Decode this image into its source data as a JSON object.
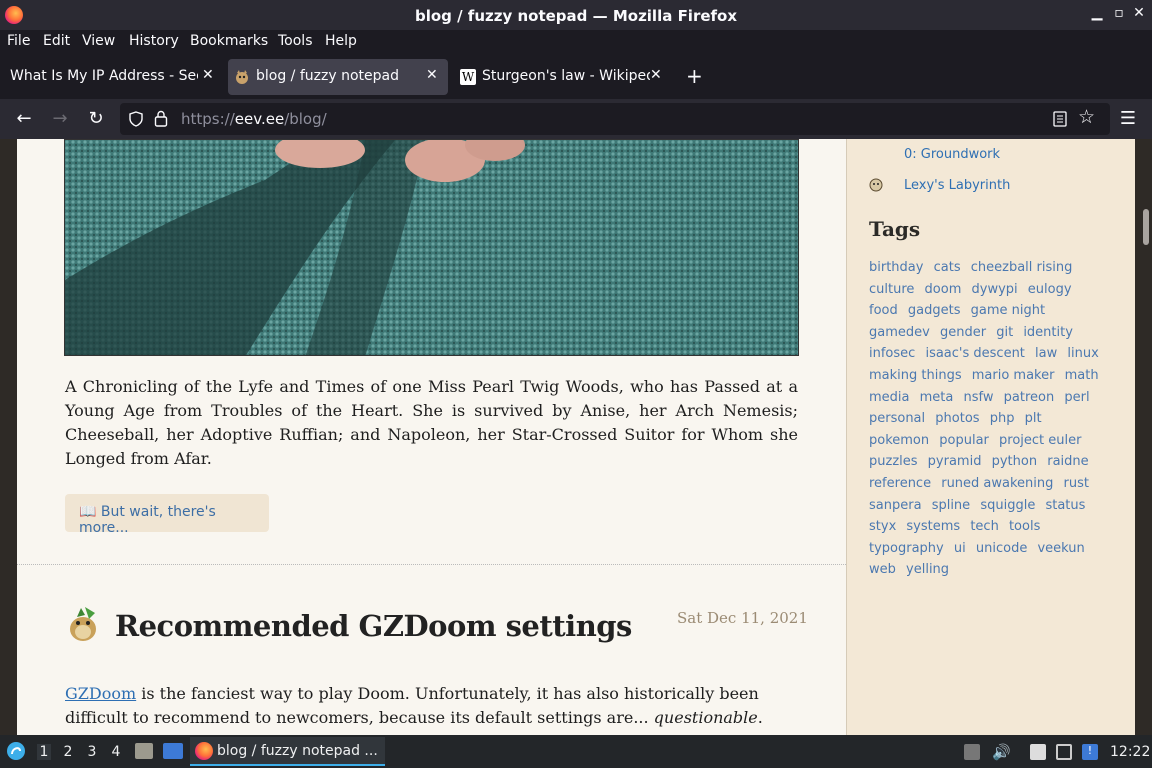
{
  "window": {
    "title": "blog / fuzzy notepad — Mozilla Firefox"
  },
  "menu": [
    "File",
    "Edit",
    "View",
    "History",
    "Bookmarks",
    "Tools",
    "Help"
  ],
  "tabs": [
    {
      "label": "What Is My IP Address - See",
      "active": false
    },
    {
      "label": "blog / fuzzy notepad",
      "active": true
    },
    {
      "label": "Sturgeon's law - Wikiped",
      "active": false
    }
  ],
  "urlbar": {
    "scheme": "https://",
    "host": "eev.ee",
    "path": "/blog/"
  },
  "article": {
    "paragraph": "A Chronicling of the Lyfe and Times of one Miss Pearl Twig Woods, who has Passed at a Young Age from Troubles of the Heart. She is survived by Anise, her Arch Nemesis; Cheeseball, her Adoptive Ruffian; and Napoleon, her Star-Crossed Suitor for Whom she Longed from Afar.",
    "more_button": "📖 But wait, there's more..."
  },
  "next_post": {
    "title": "Recommended GZDoom settings",
    "date": "Sat Dec 11, 2021",
    "link_text": "GZDoom",
    "line1": " is the fanciest way to play Doom. Unfortunately, it has also historically been",
    "line2": "difficult to recommend to newcomers, because its default settings are... ",
    "emph": "questionable",
    "end": "."
  },
  "sidebar": {
    "projects": [
      "0: Groundwork",
      "Lexy's Labyrinth"
    ],
    "tags_heading": "Tags",
    "tags": [
      "birthday",
      "cats",
      "cheezball rising",
      "culture",
      "doom",
      "dywypi",
      "eulogy",
      "food",
      "gadgets",
      "game night",
      "gamedev",
      "gender",
      "git",
      "identity",
      "infosec",
      "isaac's descent",
      "law",
      "linux",
      "making things",
      "mario maker",
      "math",
      "media",
      "meta",
      "nsfw",
      "patreon",
      "perl",
      "personal",
      "photos",
      "php",
      "plt",
      "pokemon",
      "popular",
      "project euler",
      "puzzles",
      "pyramid",
      "python",
      "raidne",
      "reference",
      "runed awakening",
      "rust",
      "sanpera",
      "spline",
      "squiggle",
      "status",
      "styx",
      "systems",
      "tech",
      "tools",
      "typography",
      "ui",
      "unicode",
      "veekun",
      "web",
      "yelling"
    ]
  },
  "taskbar": {
    "workspaces": [
      "1",
      "2",
      "3",
      "4"
    ],
    "task_label": "blog / fuzzy notepad ...",
    "clock": "12:22"
  }
}
